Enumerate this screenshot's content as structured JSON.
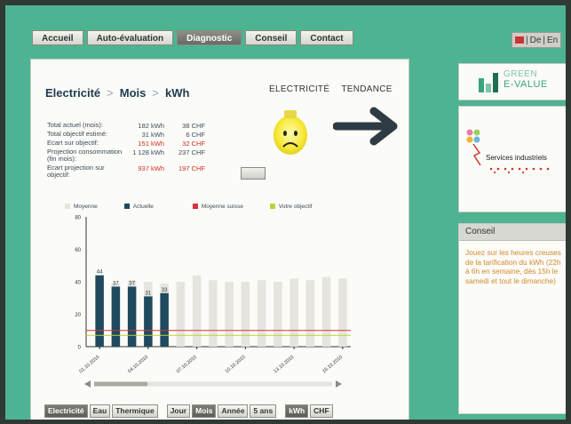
{
  "nav": {
    "tabs": [
      "Accueil",
      "Auto-évaluation",
      "Diagnostic",
      "Conseil",
      "Contact"
    ],
    "active": "Diagnostic"
  },
  "lang": {
    "de": "De",
    "en": "En",
    "sep": "|"
  },
  "breadcrumb": {
    "level1": "Electricité",
    "level2": "Mois",
    "level3": "kWh",
    "sep": ">"
  },
  "views": {
    "electricite": "ELECTRICITÉ",
    "tendance": "TENDANCE"
  },
  "stats": [
    {
      "label": "Total actuel (mois):",
      "kwh": "182 kWh",
      "chf": "38 CHF",
      "highlight": false
    },
    {
      "label": "Total objectif estimé:",
      "kwh": "31 kWh",
      "chf": "6 CHF",
      "highlight": false
    },
    {
      "label": "Ecart sur objectif:",
      "kwh": "151 kWh",
      "chf": "32 CHF",
      "highlight": true
    },
    {
      "label": "Projection consommation (fin mois):",
      "kwh": "1 128 kWh",
      "chf": "237 CHF",
      "highlight": false
    },
    {
      "label": "Ecart projection sur objectif:",
      "kwh": "937 kWh",
      "chf": "197 CHF",
      "highlight": true
    }
  ],
  "colors": {
    "moyenne": "#e6e4df",
    "actuelle": "#1f4a5e",
    "moyenne_suisse": "#d6323a",
    "objectif": "#b7d43c",
    "accent": "#3aa37f",
    "tip_text": "#d68a2a"
  },
  "chart_data": {
    "type": "bar",
    "legend": [
      "Moyenne",
      "Actuelle",
      "Moyenne suisse",
      "Votre objectif"
    ],
    "legend_placement": "top",
    "ylim": [
      0,
      80
    ],
    "yticks": [
      0,
      20,
      40,
      60,
      80
    ],
    "x_tick_labels": [
      "01.10.2010",
      "04.10.2010",
      "07.10.2010",
      "10.10.2010",
      "13.10.2010",
      "16.10.2010"
    ],
    "series": [
      {
        "name": "Moyenne",
        "values": [
          42,
          39,
          41,
          40,
          39,
          40,
          44,
          41,
          40,
          40,
          41,
          40,
          42,
          41,
          43,
          42
        ]
      },
      {
        "name": "Actuelle",
        "values": [
          44,
          37,
          37,
          31,
          33,
          null,
          null,
          null,
          null,
          null,
          null,
          null,
          null,
          null,
          null,
          null
        ]
      }
    ],
    "data_labels": [
      "44",
      "37",
      "37",
      "31",
      "33"
    ],
    "lines": [
      {
        "name": "Moyenne suisse",
        "value": 10
      },
      {
        "name": "Votre objectif",
        "value": 7
      }
    ],
    "grid": false
  },
  "bottom": {
    "energy": [
      "Electricité",
      "Eau",
      "Thermique"
    ],
    "period": [
      "Jour",
      "Mois",
      "Année",
      "5 ans"
    ],
    "unit": [
      "kWh",
      "CHF"
    ],
    "active": [
      "Electricité",
      "Mois",
      "kWh"
    ]
  },
  "logo": {
    "line1": "GREEN",
    "line2": "E-VALUE"
  },
  "services": {
    "name": "Services industriels"
  },
  "tip": {
    "title": "Conseil",
    "text": "Jouez sur les heures creuses de la tarification du kWh (22h à 6h en semaine, dès 15h le samedi et tout le dimanche)"
  }
}
